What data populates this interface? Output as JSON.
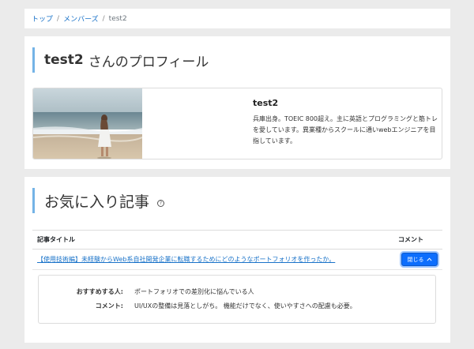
{
  "breadcrumb": {
    "top": "トップ",
    "members": "メンバーズ",
    "current": "test2"
  },
  "profile": {
    "username": "test2",
    "heading_suffix": "さんのプロフィール",
    "display_name": "test2",
    "bio": "兵庫出身。TOEIC 800超え。主に英語とプログラミングと筋トレを愛しています。異業種からスクールに通いwebエンジニアを目指しています。"
  },
  "favorites": {
    "heading": "お気に入り記事",
    "help_icon_glyph": "?",
    "columns": {
      "title": "記事タイトル",
      "comment": "コメント"
    },
    "rows": [
      {
        "title": "【使用技術編】未経験からWeb系自社開発企業に転職するためにどのようなポートフォリオを作ったか。",
        "button_label": "閉じる",
        "button_icon": "chevron-up-icon"
      }
    ],
    "detail": {
      "recommend_label": "おすすめする人:",
      "recommend_value": "ポートフォリオでの差別化に悩んでいる人",
      "comment_label": "コメント:",
      "comment_value": "UI/UXの整備は見落としがち。 機能だけでなく、使いやすさへの配慮も必要。"
    }
  },
  "colors": {
    "link": "#1a73c9",
    "accent_bar": "#74b3e6",
    "button_bg": "#0d6efd"
  }
}
